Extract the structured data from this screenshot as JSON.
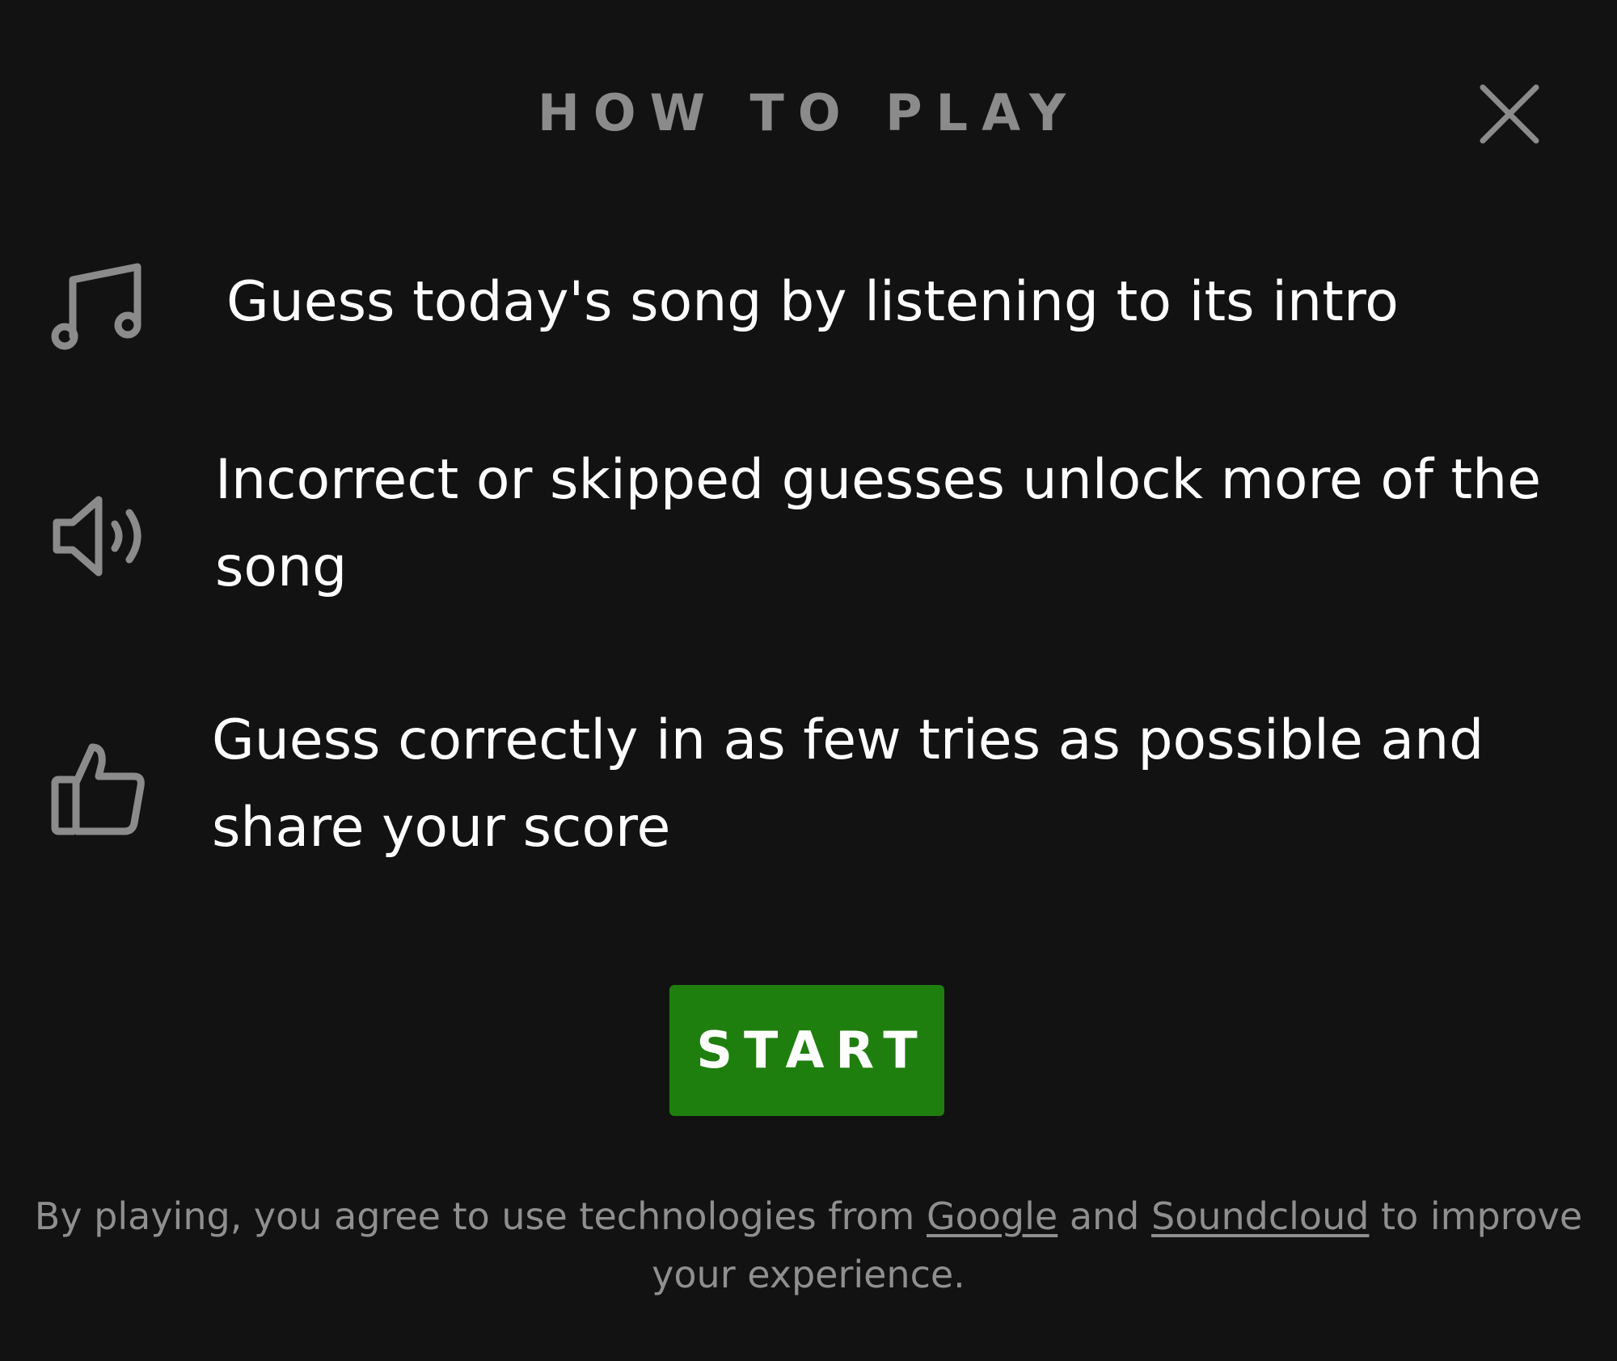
{
  "modal": {
    "title": "HOW TO PLAY",
    "close_icon": "close-icon"
  },
  "rules": [
    {
      "icon": "music-note-icon",
      "text": "Guess today's song by listening to its intro"
    },
    {
      "icon": "speaker-volume-icon",
      "text": "Incorrect or skipped guesses unlock more of the song"
    },
    {
      "icon": "thumbs-up-icon",
      "text": "Guess correctly in as few tries as possible and share your score"
    }
  ],
  "start_button": {
    "label": "START"
  },
  "footer": {
    "prefix": "By playing, you agree to use technologies from",
    "link_google": "Google",
    "middle": "and",
    "link_soundcloud": "Soundcloud",
    "suffix": "to improve your experience."
  },
  "colors": {
    "background": "#121212",
    "title": "#8b8b8b",
    "icon": "#8b8b8b",
    "text": "#ffffff",
    "start_button": "#1f7f0e",
    "footer": "#8f8f8f"
  }
}
